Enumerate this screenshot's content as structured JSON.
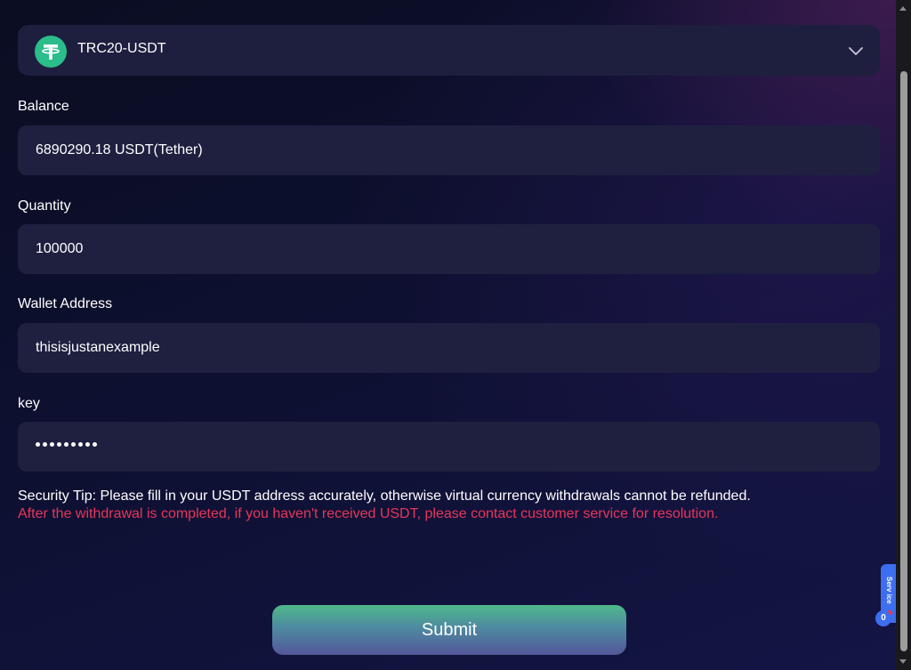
{
  "currency_selector": {
    "selected": "TRC20-USDT",
    "icon": "tether-icon"
  },
  "balance": {
    "label": "Balance",
    "value": "6890290.18 USDT(Tether)"
  },
  "quantity": {
    "label": "Quantity",
    "value": "100000"
  },
  "wallet_address": {
    "label": "Wallet Address",
    "value": "thisisjustanexample"
  },
  "key": {
    "label": "key",
    "masked_length": 9
  },
  "security_tip": "Security Tip: Please fill in your USDT address accurately, otherwise virtual currency withdrawals cannot be refunded.",
  "warning": "After the withdrawal is completed, if you haven't received USDT, please contact customer service for resolution.",
  "submit_label": "Submit",
  "service": {
    "label": "Serv ice",
    "badge": "0"
  },
  "colors": {
    "accent_green": "#4fb88a",
    "warning_red": "#e8355a",
    "service_blue": "#3d6ef0",
    "tether_green": "#2bbd8a"
  }
}
